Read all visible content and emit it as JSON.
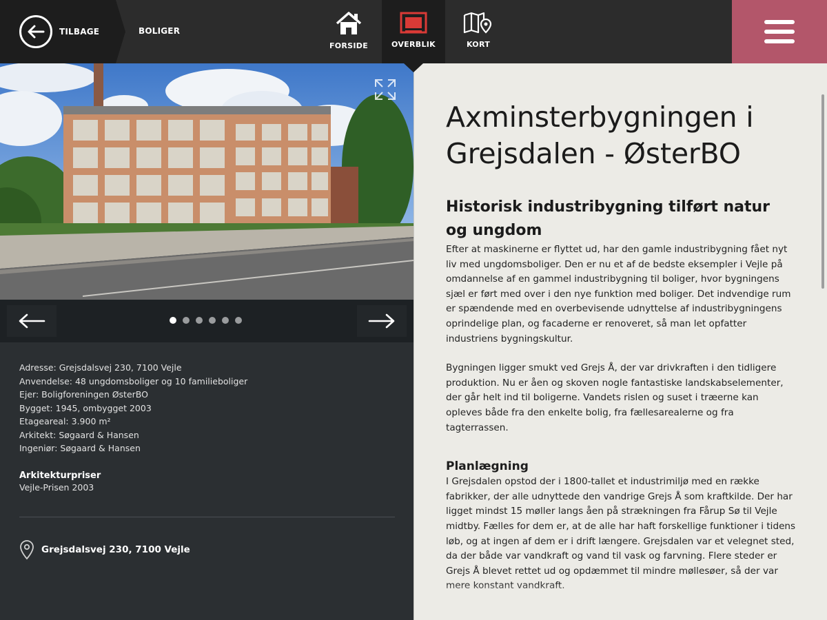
{
  "header": {
    "back_label": "TILBAGE",
    "breadcrumb": "BOLIGER",
    "nav": [
      {
        "label": "FORSIDE",
        "icon": "home-icon"
      },
      {
        "label": "OVERBLIK",
        "icon": "overview-icon"
      },
      {
        "label": "KORT",
        "icon": "map-icon"
      }
    ],
    "active_nav": "OVERBLIK",
    "menu_icon": "hamburger-icon",
    "colors": {
      "bar": "#2c2c2c",
      "active": "#1d1d1d",
      "menu": "#b3566a",
      "accent": "#d93a36"
    }
  },
  "gallery": {
    "photo_alt": "Axminsterbygningen photo",
    "slide_count": 6,
    "active_slide": 1
  },
  "facts": {
    "lines": [
      "Adresse: Grejsdalsvej 230, 7100 Vejle",
      "Anvendelse: 48 ungdomsboliger og 10 familieboliger",
      "Ejer: Boligforeningen ØsterBO",
      "Bygget: 1945, ombygget 2003",
      "Etageareal: 3.900 m²",
      "Arkitekt: Søgaard & Hansen",
      "Ingeniør: Søgaard & Hansen"
    ],
    "awards_heading": "Arkitekturpriser",
    "awards_value": "Vejle-Prisen 2003",
    "address_link": "Grejsdalsvej 230, 7100 Vejle"
  },
  "article": {
    "title": "Axminsterbygningen i Grejsdalen - ØsterBO",
    "subtitle": "Historisk industribygning tilført natur og ungdom",
    "paragraphs": [
      "Efter at maskinerne er flyttet ud, har den gamle industribygning fået nyt liv med ungdomsboliger. Den er nu et af de bedste eksempler i Vejle på omdannelse af en gammel industribygning til boliger, hvor bygningens sjæl er ført med over i den nye funktion med boliger. Det indvendige rum er spændende med en overbevisende udnyttelse af industribygningens oprindelige plan, og facaderne er renoveret, så man let opfatter industriens bygningskultur.",
      "Bygningen ligger smukt ved Grejs Å, der var drivkraften i den tidligere produktion. Nu er åen og skoven nogle fantastiske landskabselementer, der går helt ind til boligerne. Vandets rislen og suset i træerne kan opleves både fra den enkelte bolig, fra fællesarealerne og fra tagterrassen."
    ],
    "section_heading": "Planlægning",
    "section_paragraph": "I Grejsdalen opstod der i 1800-tallet et industrimiljø med en række fabrikker, der alle udnyttede den vandrige Grejs Å som kraftkilde. Der har ligget mindst 15 møller langs åen på strækningen fra Fårup Sø til Vejle midtby. Fælles for dem er, at de alle har haft forskellige funktioner i tidens løb, og at ingen af dem er i drift længere. Grejsdalen var et velegnet sted, da der både var vandkraft og vand til vask og farvning. Flere steder er Grejs Å blevet rettet ud og opdæmmet til mindre møllesøer, så der var mere konstant vandkraft."
  }
}
